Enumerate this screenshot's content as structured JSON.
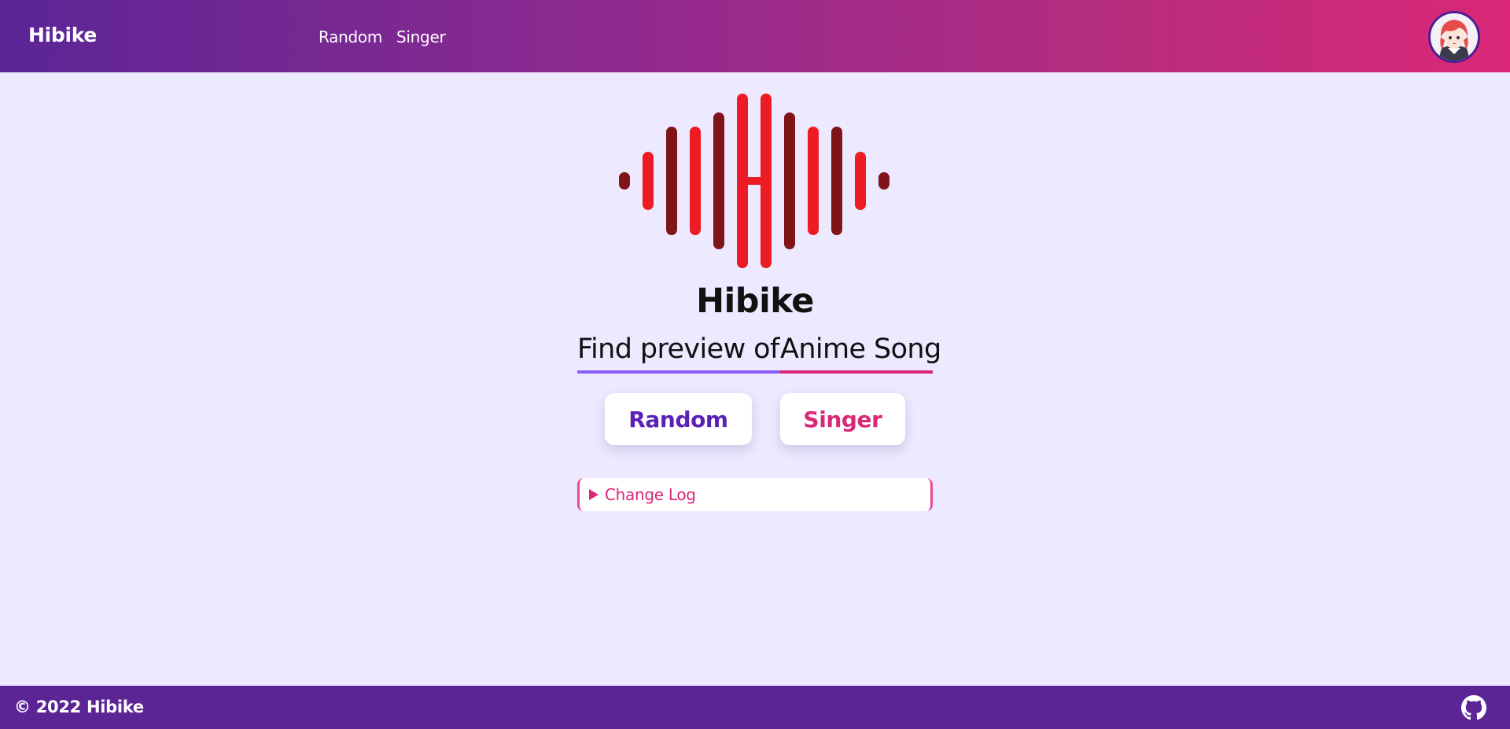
{
  "navbar": {
    "brand": "Hibike",
    "links": [
      {
        "label": "Random"
      },
      {
        "label": "Singer"
      }
    ],
    "avatar_icon": "anime-girl-avatar"
  },
  "main": {
    "title": "Hibike",
    "tagline_part1": "Find preview of ",
    "tagline_part2": "Anime Song",
    "buttons": {
      "random": "Random",
      "singer": "Singer"
    },
    "changelog_label": "Change Log"
  },
  "footer": {
    "copyright": "© 2022 Hibike",
    "github_icon": "github-icon"
  },
  "colors": {
    "header_gradient_start": "#5b2596",
    "header_gradient_end": "#db2777",
    "background": "#ede9fe",
    "footer": "#5b2596",
    "accent_purple": "#5b21b6",
    "accent_pink": "#db2777",
    "logo_bright_red": "#ed1c24",
    "logo_dark_red": "#7f1518"
  }
}
